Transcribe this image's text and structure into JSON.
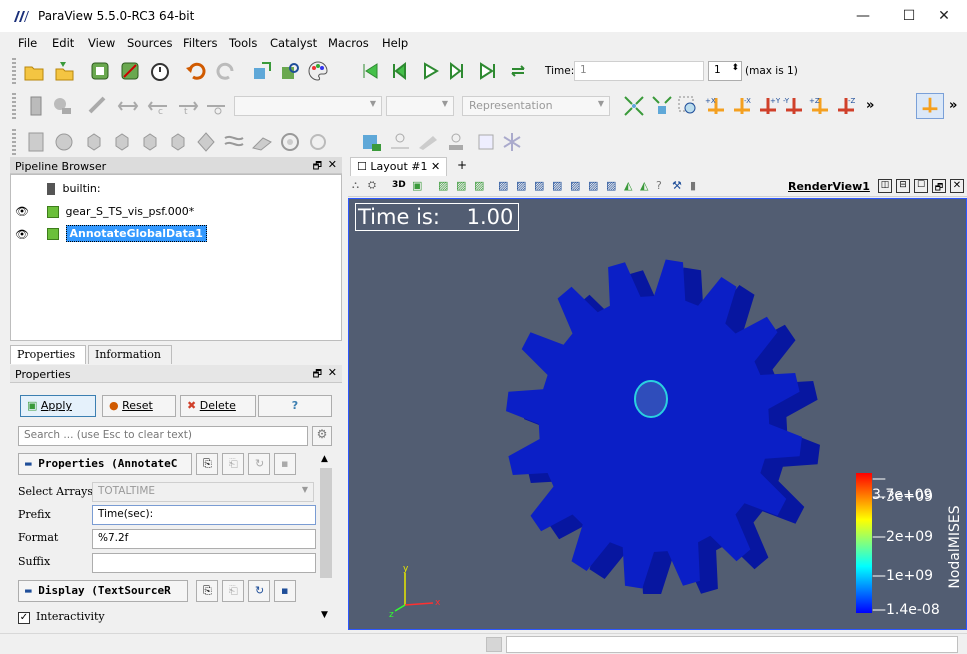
{
  "window": {
    "title": "ParaView 5.5.0-RC3 64-bit",
    "minimize": "—",
    "maximize": "☐",
    "close": "✕"
  },
  "menu": [
    "File",
    "Edit",
    "View",
    "Sources",
    "Filters",
    "Tools",
    "Catalyst",
    "Macros",
    "Help"
  ],
  "toolbar": {
    "time_label": "Time:",
    "time_value": "1",
    "time_index": "1",
    "max_label": "(max is 1)",
    "representation": "Representation",
    "more": "»"
  },
  "pipeline": {
    "header": "Pipeline Browser",
    "items": [
      {
        "label": "builtin:"
      },
      {
        "label": "gear_S_TS_vis_psf.000*"
      },
      {
        "label": "AnnotateGlobalData1"
      }
    ]
  },
  "panel_tabs": [
    "Properties",
    "Information"
  ],
  "properties": {
    "header": "Properties",
    "apply": "Apply",
    "reset": "Reset",
    "delete": "Delete",
    "help": "?",
    "search_placeholder": "Search ... (use Esc to clear text)",
    "section1": "Properties (AnnotateC",
    "select_arrays_label": "Select Arrays",
    "select_arrays_value": "TOTALTIME",
    "prefix_label": "Prefix",
    "prefix_value": "Time(sec):",
    "format_label": "Format",
    "format_value": "%7.2f",
    "suffix_label": "Suffix",
    "suffix_value": "",
    "section2": "Display (TextSourceR",
    "interactivity": "Interactivity"
  },
  "layout": {
    "tab": "Layout #1",
    "add": "+",
    "render_view": "RenderView1",
    "btn_3d": "3D"
  },
  "view": {
    "time_text": "Time is:    1.00",
    "colorbar": {
      "title": "NodalMISES",
      "labels": [
        "3.7e+09",
        "3e+09",
        "2e+09",
        "1e+09",
        "1.4e-08"
      ],
      "stops": [
        "#ff0000",
        "#ff8000",
        "#ffff00",
        "#80ff80",
        "#00ffff",
        "#0080ff",
        "#0000ff"
      ]
    },
    "axes": {
      "y": "y",
      "z": "z",
      "x": "x"
    }
  },
  "colors": {
    "gear": "#0b1fc6",
    "background": "#525d72",
    "selection": "#3399ff"
  }
}
